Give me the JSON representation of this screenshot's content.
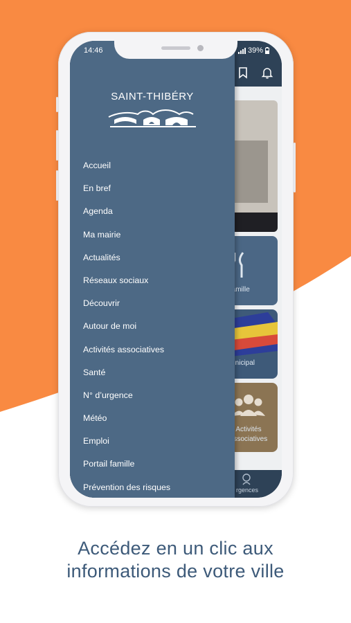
{
  "status_bar": {
    "time": "14:46",
    "battery": "39%"
  },
  "header": {
    "bookmark_icon": "bookmark-icon",
    "bell_icon": "bell-icon"
  },
  "app_logo": {
    "name": "SAINT-THIBÉRY"
  },
  "menu": {
    "items": [
      {
        "label": "Accueil"
      },
      {
        "label": "En bref"
      },
      {
        "label": "Agenda"
      },
      {
        "label": "Ma mairie"
      },
      {
        "label": "Actualités"
      },
      {
        "label": "Réseaux sociaux"
      },
      {
        "label": "Découvrir"
      },
      {
        "label": "Autour de moi"
      },
      {
        "label": "Activités associatives"
      },
      {
        "label": "Santé"
      },
      {
        "label": "N° d’urgence"
      },
      {
        "label": "Météo"
      },
      {
        "label": "Emploi"
      },
      {
        "label": "Portail famille"
      },
      {
        "label": "Prévention des risques"
      }
    ]
  },
  "tiles": {
    "portail": "rtail famille",
    "conseil": "eil municipal",
    "activites_line1": "Activités",
    "activites_line2": "associatives"
  },
  "footer": {
    "label": "rgences"
  },
  "tagline": {
    "line1": "Accédez en un clic aux",
    "line2": "informations de votre ville"
  },
  "colors": {
    "accent_orange": "#f98a42",
    "drawer_blue": "#4d6985",
    "dark_navy": "#2e4257",
    "tagline_blue": "#3d5a79"
  }
}
